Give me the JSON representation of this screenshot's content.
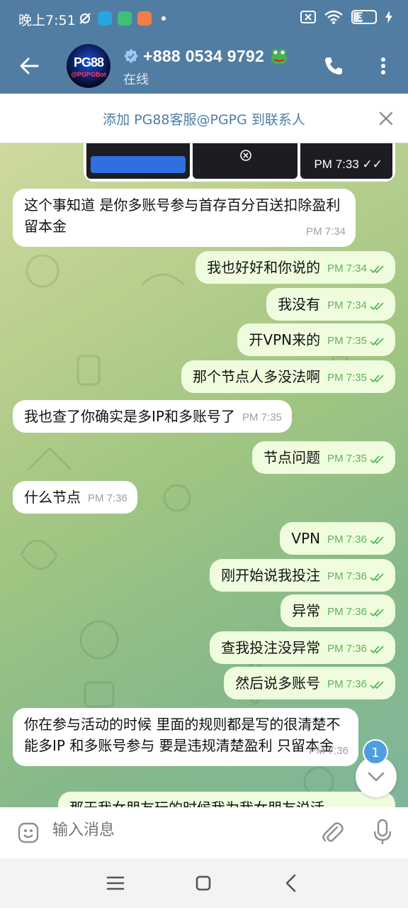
{
  "status_bar": {
    "time": "晚上7:51",
    "battery": "37"
  },
  "header": {
    "title": "+888 0534 9792",
    "subtitle": "在线",
    "avatar_text": "PG88",
    "avatar_subtext": "@PGPGBot"
  },
  "banner": {
    "text": "添加 PG88客服@PGPG 到联系人"
  },
  "preview": {
    "time": "PM 7:33"
  },
  "messages": [
    {
      "dir": "in",
      "text": "这个事知道 是你多账号参与首存百分百送扣除盈利  留本金",
      "time": "PM 7:34"
    },
    {
      "dir": "out",
      "text": "我也好好和你说的",
      "time": "PM 7:34"
    },
    {
      "dir": "out",
      "text": "我没有",
      "time": "PM 7:34"
    },
    {
      "dir": "out",
      "text": "开VPN来的",
      "time": "PM 7:35"
    },
    {
      "dir": "out",
      "text": "那个节点人多没法啊",
      "time": "PM 7:35"
    },
    {
      "dir": "in",
      "text": "我也查了你确实是多IP和多账号了",
      "time": "PM 7:35"
    },
    {
      "dir": "out",
      "text": "节点问题",
      "time": "PM 7:35"
    },
    {
      "dir": "in",
      "text": "什么节点",
      "time": "PM 7:36"
    },
    {
      "dir": "out",
      "text": "VPN",
      "time": "PM 7:36"
    },
    {
      "dir": "out",
      "text": "刚开始说我投注",
      "time": "PM 7:36"
    },
    {
      "dir": "out",
      "text": "异常",
      "time": "PM 7:36"
    },
    {
      "dir": "out",
      "text": "查我投注没异常",
      "time": "PM 7:36"
    },
    {
      "dir": "out",
      "text": "然后说多账号",
      "time": "PM 7:36"
    },
    {
      "dir": "in",
      "text": "你在参与活动的时候 里面的规则都是写的很清楚不能多IP 和多账号参与 要是违规清楚盈利 只留本金",
      "time": "PM 7:36"
    },
    {
      "dir": "out",
      "text": "那天我女朋友玩的时候我为我女朋友说活",
      "time": ""
    }
  ],
  "unread_badge": "1",
  "input": {
    "placeholder": "输入消息"
  },
  "icons": {
    "back": "arrow-left-icon",
    "call": "phone-icon",
    "more": "more-vertical-icon",
    "close": "close-icon",
    "emoji": "sticker-icon",
    "attach": "paperclip-icon",
    "mic": "microphone-icon"
  },
  "colors": {
    "header": "#527da3",
    "outgoing": "#effdde",
    "incoming": "#ffffff",
    "check": "#5fb35a",
    "accent": "#4e9ee0"
  }
}
